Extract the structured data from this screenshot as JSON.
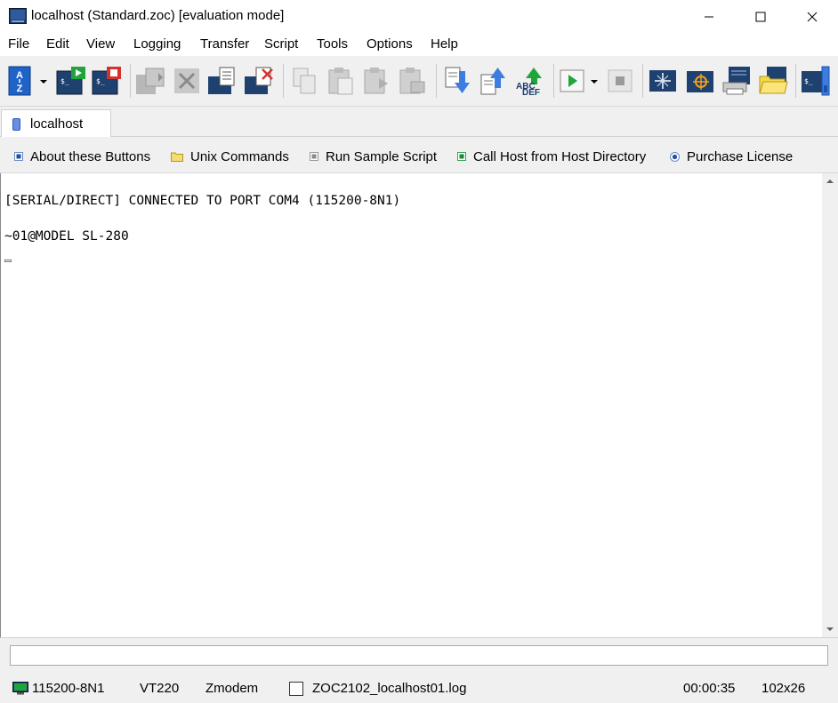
{
  "window": {
    "title": "localhost (Standard.zoc) [evaluation mode]",
    "controls": [
      "minimize",
      "maximize",
      "close"
    ]
  },
  "menu": {
    "items": [
      "File",
      "Edit",
      "View",
      "Logging",
      "Transfer",
      "Script",
      "Tools",
      "Options",
      "Help"
    ]
  },
  "toolbar": {
    "icons": [
      "address-book-icon",
      "connect-icon",
      "disconnect-icon",
      "copy-screen-icon",
      "cancel-icon",
      "capture-icon",
      "capture-stop-icon",
      "copy-icon",
      "paste-icon",
      "paste-special-icon",
      "print-icon",
      "download-icon",
      "upload-icon",
      "translate-icon",
      "run-script-icon",
      "stop-script-icon",
      "host-directory-icon",
      "telnet-icon",
      "window-icon",
      "printer-icon",
      "folder-icon",
      "terminal-icon"
    ]
  },
  "tabs": [
    {
      "label": "localhost",
      "active": true
    }
  ],
  "user_buttons": [
    {
      "label": "About these Buttons",
      "icon": "blue-square-icon"
    },
    {
      "label": "Unix Commands",
      "icon": "folder-icon"
    },
    {
      "label": "Run Sample Script",
      "icon": "gray-square-icon"
    },
    {
      "label": "Call Host from Host Directory",
      "icon": "green-square-icon"
    },
    {
      "label": "Purchase License",
      "icon": "blue-radio-icon"
    }
  ],
  "terminal": {
    "lines": [
      "[SERIAL/DIRECT] CONNECTED TO PORT COM4 (115200-8N1)",
      "~01@MODEL SL-280"
    ]
  },
  "input": {
    "value": ""
  },
  "status": {
    "connection": "115200-8N1",
    "emulation": "VT220",
    "transfer": "Zmodem",
    "logfile": "ZOC2102_localhost01.log",
    "log_enabled": false,
    "timer": "00:00:35",
    "size": "102x26"
  },
  "colors": {
    "chrome": "#f0f0f0",
    "accent_blue": "#1f63c8",
    "accent_green": "#1fa53a",
    "accent_red": "#d4322c",
    "terminal_bg": "#ffffff",
    "terminal_fg": "#000000"
  }
}
